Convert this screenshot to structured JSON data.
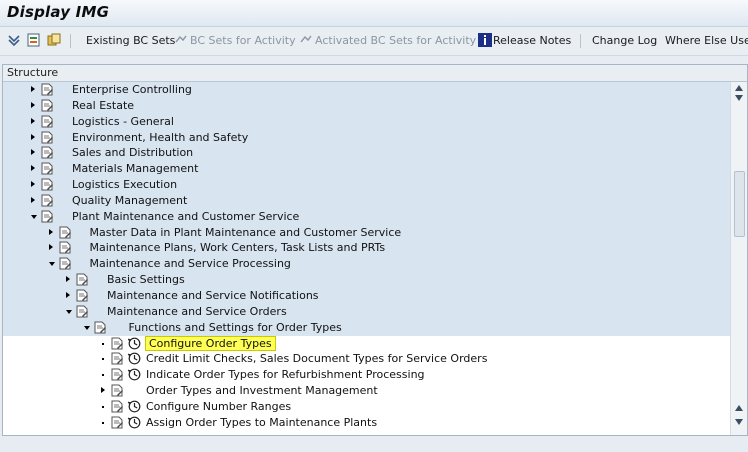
{
  "window": {
    "title": "Display IMG"
  },
  "toolbar": {
    "existing_bc_sets": "Existing BC Sets",
    "bc_sets_for_activity": "BC Sets for Activity",
    "activated_bc_sets_for_activity": "Activated BC Sets for Activity",
    "release_notes": "Release Notes",
    "change_log": "Change Log",
    "where_else_used": "Where Else Used"
  },
  "tree": {
    "header": "Structure",
    "rows": [
      {
        "label": "Enterprise Controlling",
        "level": 1,
        "expander": "right",
        "clock": false
      },
      {
        "label": "Real Estate",
        "level": 1,
        "expander": "right",
        "clock": false
      },
      {
        "label": "Logistics - General",
        "level": 1,
        "expander": "right",
        "clock": false
      },
      {
        "label": "Environment, Health and Safety",
        "level": 1,
        "expander": "right",
        "clock": false
      },
      {
        "label": "Sales and Distribution",
        "level": 1,
        "expander": "right",
        "clock": false
      },
      {
        "label": "Materials Management",
        "level": 1,
        "expander": "right",
        "clock": false
      },
      {
        "label": "Logistics Execution",
        "level": 1,
        "expander": "right",
        "clock": false
      },
      {
        "label": "Quality Management",
        "level": 1,
        "expander": "right",
        "clock": false
      },
      {
        "label": "Plant Maintenance and Customer Service",
        "level": 1,
        "expander": "down",
        "clock": false
      },
      {
        "label": "Master Data in Plant Maintenance and Customer Service",
        "level": 2,
        "expander": "right",
        "clock": false
      },
      {
        "label": "Maintenance Plans, Work Centers, Task Lists and PRTs",
        "level": 2,
        "expander": "right",
        "clock": false
      },
      {
        "label": "Maintenance and Service Processing",
        "level": 2,
        "expander": "down",
        "clock": false
      },
      {
        "label": "Basic Settings",
        "level": 3,
        "expander": "right",
        "clock": false
      },
      {
        "label": "Maintenance and Service Notifications",
        "level": 3,
        "expander": "right",
        "clock": false
      },
      {
        "label": "Maintenance and Service Orders",
        "level": 3,
        "expander": "down",
        "clock": false
      },
      {
        "label": "Functions and Settings for Order Types",
        "level": 4,
        "expander": "down",
        "clock": false
      },
      {
        "label": "Configure Order Types",
        "level": 5,
        "expander": "dot",
        "clock": true,
        "highlight": true
      },
      {
        "label": "Credit Limit Checks, Sales Document Types for Service Orders",
        "level": 5,
        "expander": "dot",
        "clock": true
      },
      {
        "label": "Indicate Order Types for Refurbishment Processing",
        "level": 5,
        "expander": "dot",
        "clock": true
      },
      {
        "label": "Order Types and Investment Management",
        "level": 5,
        "expander": "right",
        "clock": false
      },
      {
        "label": "Configure Number Ranges",
        "level": 5,
        "expander": "dot",
        "clock": true
      },
      {
        "label": "Assign Order Types to Maintenance Plants",
        "level": 5,
        "expander": "dot",
        "clock": true
      }
    ]
  },
  "colors": {
    "selected_row": "#d8e4f0",
    "highlight": "#ffff55",
    "toolbar_disabled": "#8a96a3"
  }
}
